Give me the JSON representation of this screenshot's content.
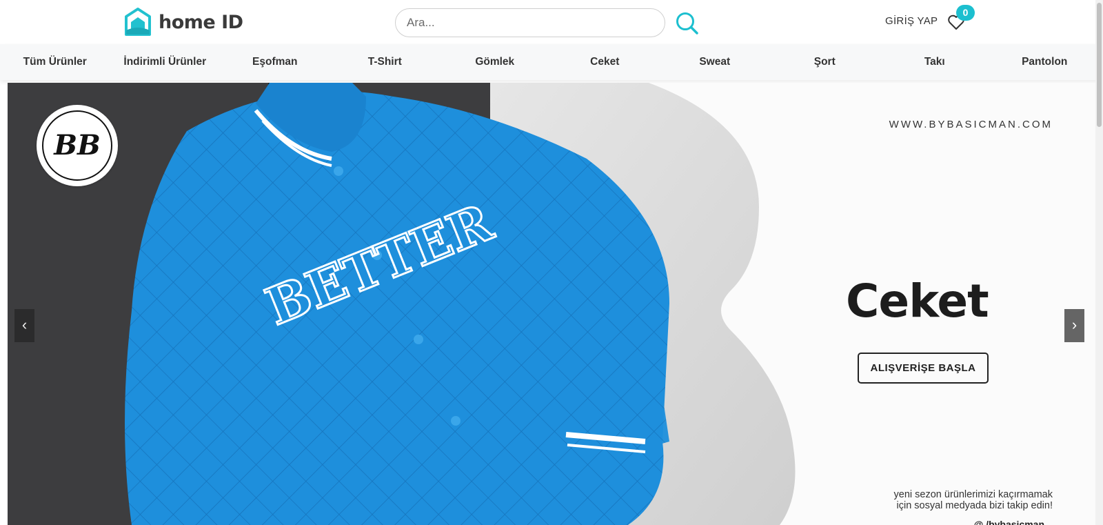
{
  "header": {
    "logo": {
      "text_main": "home",
      "text_bold": "ID"
    },
    "search": {
      "placeholder": "Ara..."
    },
    "login_label": "GİRİŞ YAP",
    "favorites_count": "0"
  },
  "nav": {
    "items": [
      {
        "label": "Tüm Ürünler"
      },
      {
        "label": "İndirimli Ürünler"
      },
      {
        "label": "Eşofman"
      },
      {
        "label": "T-Shirt"
      },
      {
        "label": "Gömlek"
      },
      {
        "label": "Ceket"
      },
      {
        "label": "Sweat"
      },
      {
        "label": "Şort"
      },
      {
        "label": "Takı"
      },
      {
        "label": "Pantolon"
      }
    ]
  },
  "hero": {
    "url_text": "WWW.BYBASICMAN.COM",
    "title": "Ceket",
    "cta_label": "ALIŞVERİŞE BAŞLA",
    "social_text_line1": "yeni sezon ürünlerimizi kaçırmamak",
    "social_text_line2": "için sosyal medyada bizi takip edin!",
    "social_handle": "@ /bybasicman",
    "jacket_print": "BETTER",
    "brand_logo_text": "BB",
    "prev_arrow": "‹",
    "next_arrow": "›"
  },
  "colors": {
    "accent": "#1cbfcf",
    "jacket_blue": "#1e8fdc",
    "dark_wall": "#3d3d3f",
    "light_wall": "#d8d8d8"
  },
  "icons": [
    "home-logo-icon",
    "search-icon",
    "heart-icon",
    "chevron-left-icon",
    "chevron-right-icon"
  ]
}
